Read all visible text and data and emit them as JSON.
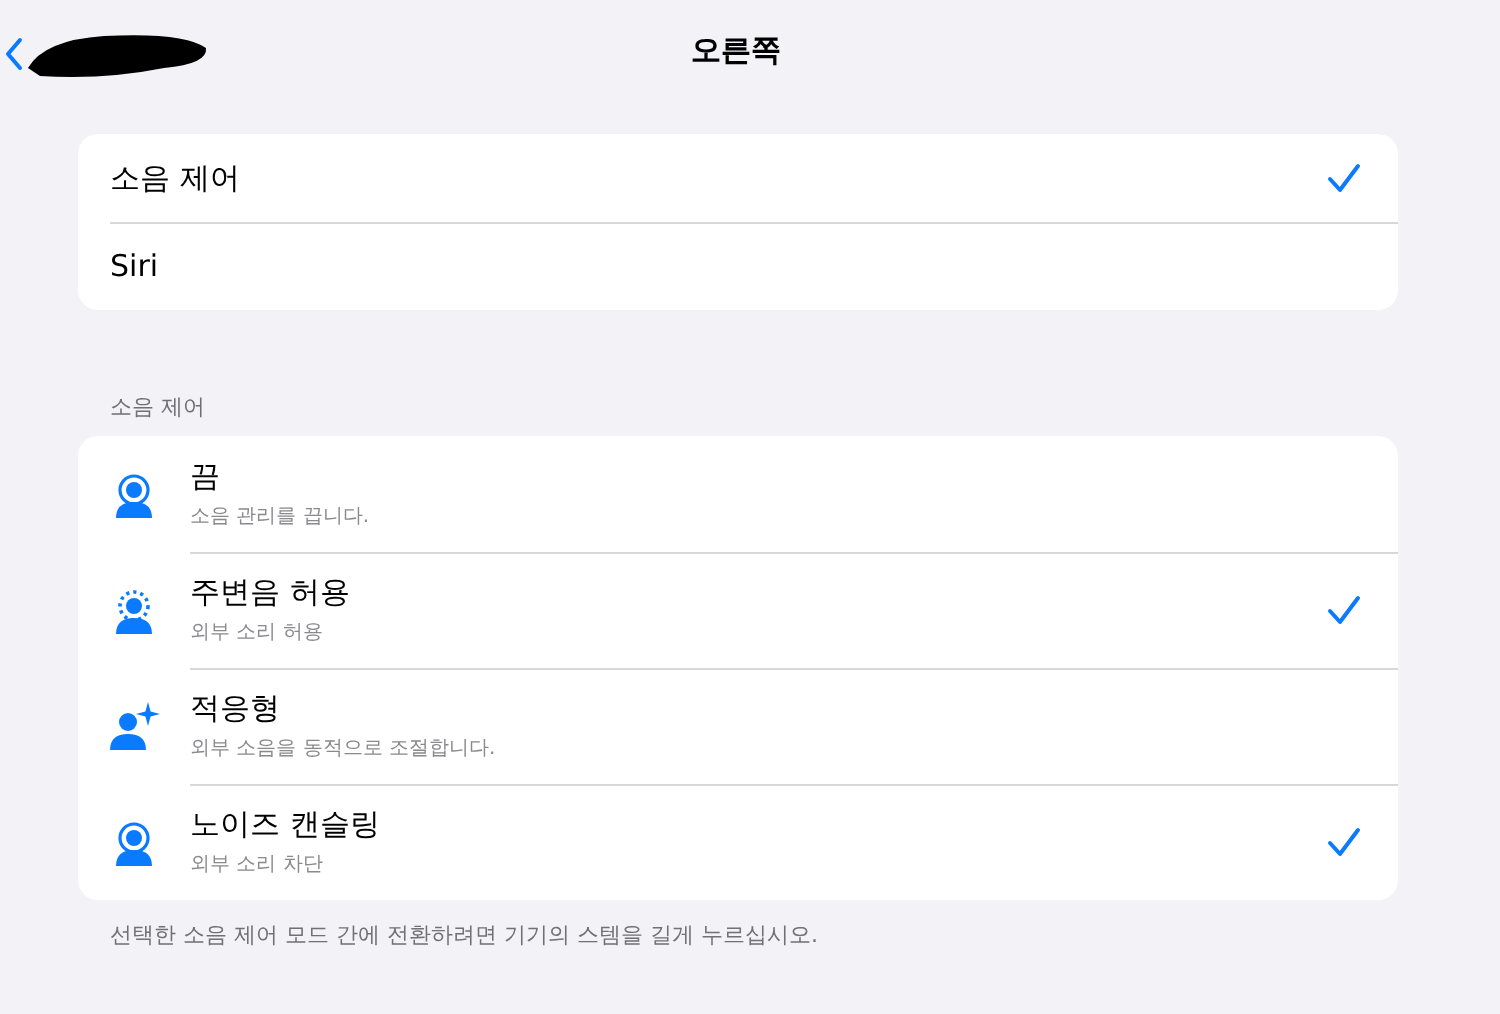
{
  "nav": {
    "title": "오른쪽"
  },
  "options": [
    {
      "label": "소음 제어",
      "selected": true
    },
    {
      "label": "Siri",
      "selected": false
    }
  ],
  "noise_control": {
    "header": "소음 제어",
    "modes": [
      {
        "kind": "off",
        "title": "끔",
        "subtitle": "소음 관리를 끕니다.",
        "checked": false
      },
      {
        "kind": "transparency",
        "title": "주변음 허용",
        "subtitle": "외부 소리 허용",
        "checked": true
      },
      {
        "kind": "adaptive",
        "title": "적응형",
        "subtitle": "외부 소음을 동적으로 조절합니다.",
        "checked": false
      },
      {
        "kind": "cancelling",
        "title": "노이즈 캔슬링",
        "subtitle": "외부 소리 차단",
        "checked": true
      }
    ],
    "footer": "선택한 소음 제어 모드 간에 전환하려면 기기의 스템을 길게 누르십시오."
  }
}
